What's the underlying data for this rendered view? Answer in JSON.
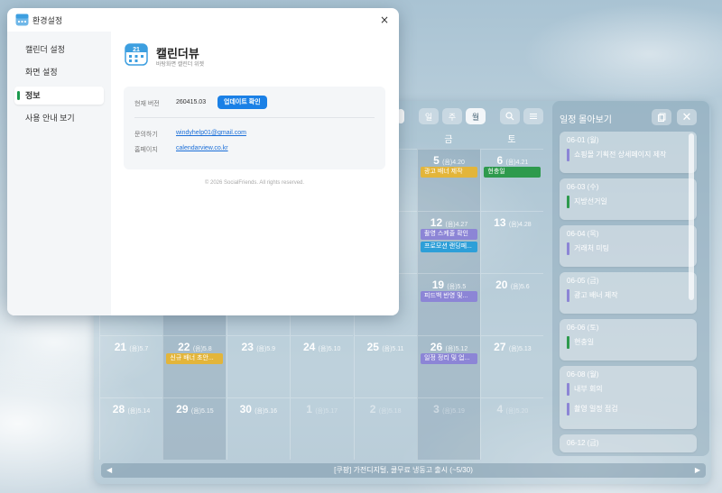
{
  "settings_dialog": {
    "title": "환경설정",
    "close_symbol": "×",
    "sidebar": [
      {
        "label": "캘린더 설정",
        "active": false
      },
      {
        "label": "화면 설정",
        "active": false
      },
      {
        "label": "정보",
        "active": true
      },
      {
        "label": "사용 안내 보기",
        "active": false
      }
    ],
    "about": {
      "app_name": "캘린더뷰",
      "tagline": "바탕화면 캘린더 위젯",
      "version_label": "현재 버전",
      "version_value": "260415.03",
      "update_button": "업데이트 확인",
      "contact_label": "문의하기",
      "contact_email": "windyhelp01@gmail.com",
      "homepage_label": "홈페이지",
      "homepage_url": "calendarview.co.kr",
      "copyright": "© 2026 SocialFriends. All rights reserved."
    }
  },
  "calendar": {
    "view_buttons": [
      {
        "label": "일",
        "active": false
      },
      {
        "label": "주",
        "active": false
      },
      {
        "label": "월",
        "active": true
      }
    ],
    "tool_icons": [
      "search-icon",
      "menu-icon"
    ],
    "weekday_headers": [
      "금",
      "토"
    ],
    "weeks": [
      [
        {
          "day": "",
          "lunar": ""
        },
        {
          "day": "",
          "lunar": ""
        },
        {
          "day": "",
          "lunar": ""
        },
        {
          "day": "",
          "lunar": ""
        },
        {
          "day": "",
          "lunar": ""
        },
        {
          "day": "5",
          "lunar": "(음)4.20",
          "events": [
            {
              "text": "광고 배너 제작",
              "color": "yellow"
            }
          ]
        },
        {
          "day": "6",
          "lunar": "(음)4.21",
          "events": [
            {
              "text": "현충일",
              "color": "green"
            }
          ]
        }
      ],
      [
        {
          "day": "",
          "lunar": ""
        },
        {
          "day": "",
          "lunar": ""
        },
        {
          "day": "",
          "lunar": ""
        },
        {
          "day": "",
          "lunar": ""
        },
        {
          "day": "",
          "lunar": ""
        },
        {
          "day": "12",
          "lunar": "(음)4.27",
          "events": [
            {
              "text": "촬영 스케줄 확인",
              "color": "purple"
            },
            {
              "text": "프로모션 랜딩페...",
              "color": "blue"
            }
          ]
        },
        {
          "day": "13",
          "lunar": "(음)4.28",
          "events": []
        }
      ],
      [
        {
          "day": "",
          "lunar": ""
        },
        {
          "day": "",
          "lunar": ""
        },
        {
          "day": "",
          "lunar": ""
        },
        {
          "day": "",
          "lunar": ""
        },
        {
          "day": "",
          "lunar": ""
        },
        {
          "day": "19",
          "lunar": "(음)5.5",
          "events": [
            {
              "text": "피드백 반영 및...",
              "color": "purple"
            }
          ]
        },
        {
          "day": "20",
          "lunar": "(음)5.6",
          "events": []
        }
      ],
      [
        {
          "day": "21",
          "lunar": "(음)5.7",
          "events": []
        },
        {
          "day": "22",
          "lunar": "(음)5.8",
          "events": [
            {
              "text": "신규 배너 초안...",
              "color": "yellow"
            }
          ]
        },
        {
          "day": "23",
          "lunar": "(음)5.9",
          "events": []
        },
        {
          "day": "24",
          "lunar": "(음)5.10",
          "events": []
        },
        {
          "day": "25",
          "lunar": "(음)5.11",
          "events": []
        },
        {
          "day": "26",
          "lunar": "(음)5.12",
          "events": [
            {
              "text": "일정 정리 및 업...",
              "color": "purple"
            }
          ]
        },
        {
          "day": "27",
          "lunar": "(음)5.13",
          "events": []
        }
      ],
      [
        {
          "day": "28",
          "lunar": "(음)5.14",
          "events": []
        },
        {
          "day": "29",
          "lunar": "(음)5.15",
          "events": []
        },
        {
          "day": "30",
          "lunar": "(음)5.16",
          "events": []
        },
        {
          "day": "1",
          "lunar": "(음)5.17",
          "dim": true,
          "events": []
        },
        {
          "day": "2",
          "lunar": "(음)5.18",
          "dim": true,
          "events": []
        },
        {
          "day": "3",
          "lunar": "(음)5.19",
          "dim": true,
          "events": []
        },
        {
          "day": "4",
          "lunar": "(음)5.20",
          "dim": true,
          "events": []
        }
      ]
    ],
    "row_three_partial": [
      "25",
      "5"
    ]
  },
  "agenda": {
    "title": "일정 몰아보기",
    "copy_icon": "copy-icon",
    "close_symbol": "✕",
    "groups": [
      {
        "date": "06-01 (월)",
        "items": [
          {
            "text": "쇼핑몰 기획전 상세페이지 제작",
            "color": "#8c85d6"
          }
        ]
      },
      {
        "date": "06-03 (수)",
        "items": [
          {
            "text": "지방선거일",
            "color": "#2e9a4d"
          }
        ]
      },
      {
        "date": "06-04 (목)",
        "items": [
          {
            "text": "거래처 미팅",
            "color": "#8c85d6"
          }
        ]
      },
      {
        "date": "06-05 (금)",
        "items": [
          {
            "text": "광고 배너 제작",
            "color": "#8c85d6"
          }
        ]
      },
      {
        "date": "06-06 (토)",
        "items": [
          {
            "text": "현충일",
            "color": "#2e9a4d"
          }
        ]
      },
      {
        "date": "06-08 (월)",
        "items": [
          {
            "text": "내부 회의",
            "color": "#8c85d6"
          },
          {
            "text": "촬영 일정 점검",
            "color": "#8c85d6"
          }
        ]
      },
      {
        "date": "06-12 (금)",
        "items": []
      }
    ]
  },
  "notice": {
    "prev": "◀",
    "text": "[쿠팡] 가전디지털, 쿨무료 냉동고 출시 (~5/30)",
    "next": "▶"
  },
  "colors": {
    "accent_green": "#1a9a4e",
    "update_button": "#1a80e6",
    "event_yellow": "#e3b53a",
    "event_green": "#2e9a4d",
    "event_purple": "#8c85d6",
    "event_blue": "#2d9fd8"
  }
}
